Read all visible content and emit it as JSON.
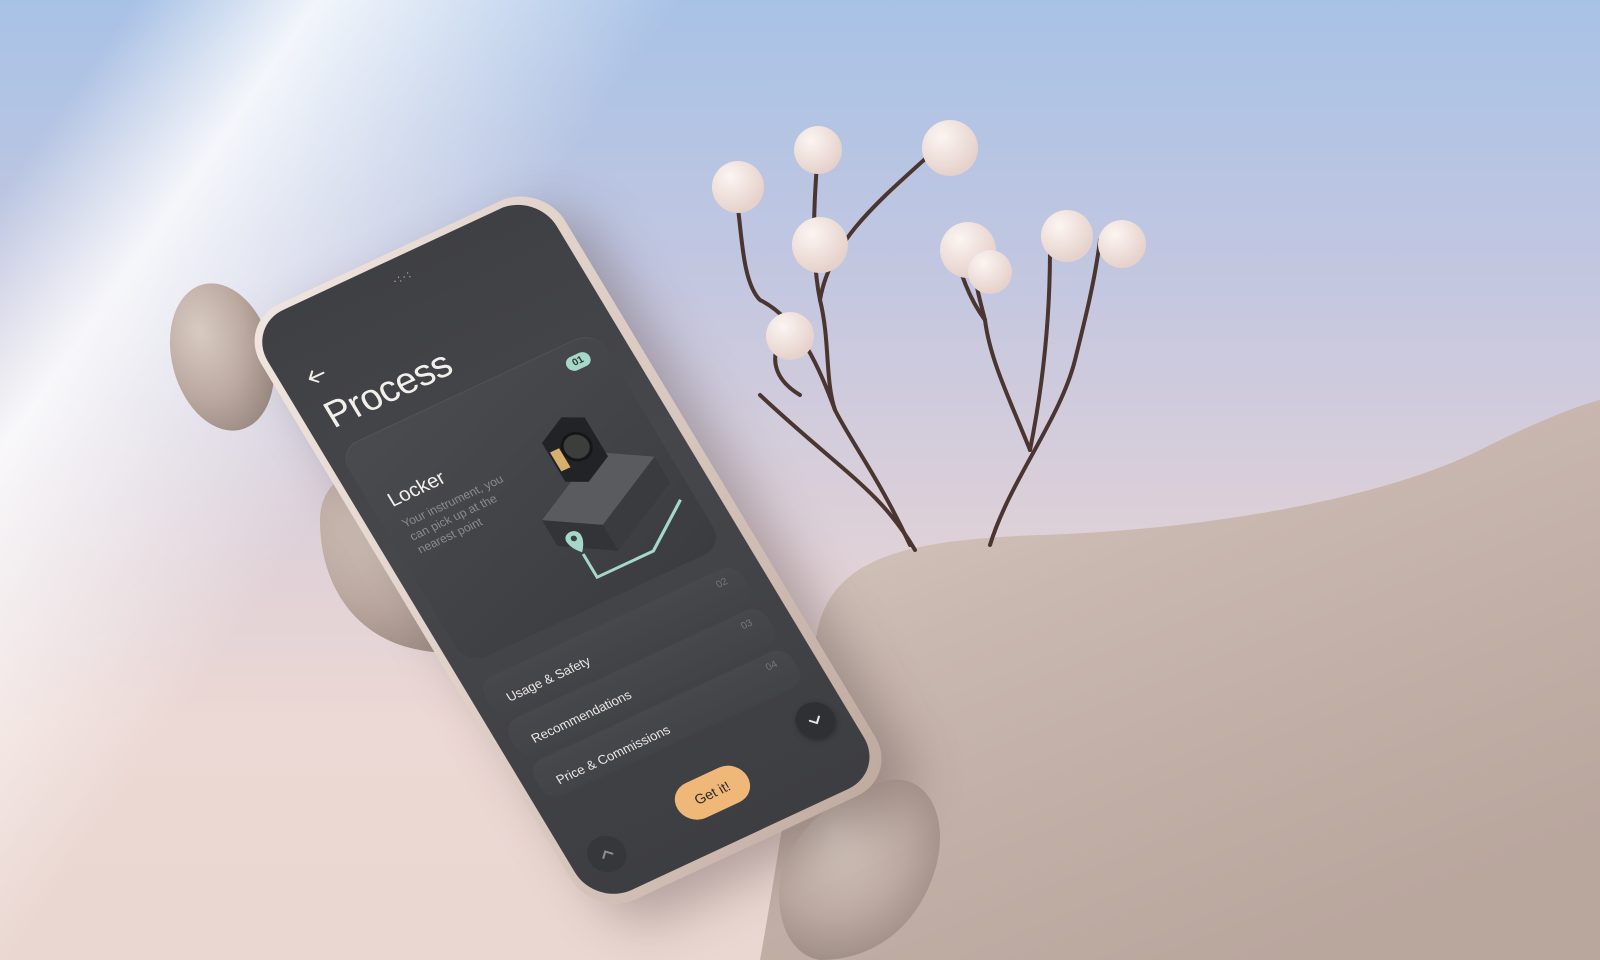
{
  "screen": {
    "notch_dots": "·:·:",
    "title": "Process",
    "card": {
      "badge": "01",
      "title": "Locker",
      "description": "Your instrument, you can pick up at the nearest point"
    },
    "list": [
      {
        "number": "02",
        "label": "Usage & Safety"
      },
      {
        "number": "03",
        "label": "Recommendations"
      },
      {
        "number": "04",
        "label": "Price & Commissions"
      }
    ],
    "cta_label": "Get it!"
  },
  "colors": {
    "accent_mint": "#a6d8c7",
    "cta_orange": "#efb879",
    "screen_bg": "#3f4044",
    "stone": "#cfbfb6",
    "branch": "#4a3530",
    "bud": "#f3e4e0"
  },
  "icons": [
    "back-arrow-icon",
    "chevron-down-icon",
    "chevron-up-icon",
    "location-pin-icon"
  ]
}
